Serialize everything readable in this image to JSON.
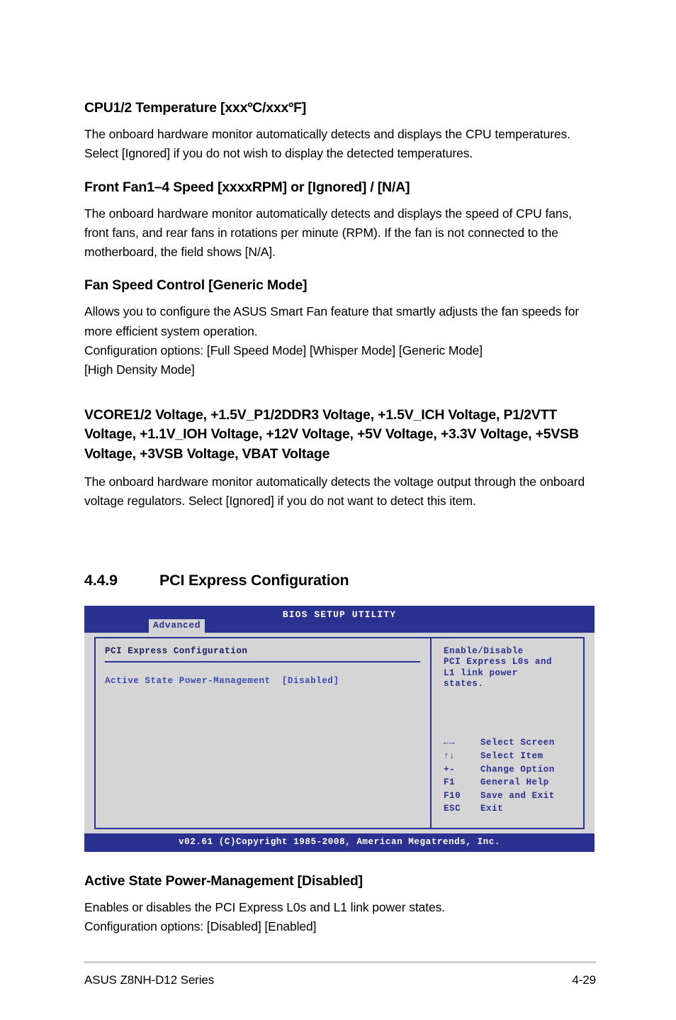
{
  "document": {
    "sections": [
      {
        "heading": "CPU1/2 Temperature [xxxºC/xxxºF]",
        "body": "The onboard hardware monitor automatically detects and displays the CPU temperatures. Select [Ignored] if you do not wish to display the detected temperatures."
      },
      {
        "heading": "Front Fan1–4 Speed [xxxxRPM] or [Ignored] / [N/A]",
        "body": "The onboard hardware monitor automatically detects and displays the speed of CPU fans, front fans, and rear fans in rotations per minute (RPM). If the fan is not connected to the motherboard, the field shows [N/A]."
      },
      {
        "heading": "Fan Speed Control [Generic Mode]",
        "body": "Allows you to configure the ASUS Smart Fan feature that smartly adjusts the fan speeds for more efficient system operation.\nConfiguration options: [Full Speed Mode] [Whisper Mode] [Generic Mode]\n[High Density Mode]"
      },
      {
        "heading": "VCORE1/2 Voltage, +1.5V_P1/2DDR3 Voltage, +1.5V_ICH Voltage, P1/2VTT Voltage, +1.1V_IOH Voltage, +12V Voltage, +5V Voltage, +3.3V Voltage, +5VSB Voltage, +3VSB Voltage, VBAT Voltage",
        "body": "The onboard hardware monitor automatically detects the voltage output through the onboard voltage regulators. Select [Ignored] if you do not want to detect this item."
      }
    ],
    "section_heading": {
      "number": "4.4.9",
      "title": "PCI Express Configuration"
    },
    "after_sections": [
      {
        "heading": "Active State Power-Management [Disabled]",
        "body": "Enables or disables the PCI Express L0s and L1 link power states.\nConfiguration options: [Disabled] [Enabled]"
      }
    ],
    "footer": {
      "left": "ASUS Z8NH-D12 Series",
      "right": "4-29"
    }
  },
  "bios": {
    "title": "BIOS SETUP UTILITY",
    "active_tab": "Advanced",
    "main_panel": {
      "sub_title": "PCI Express Configuration",
      "rows": [
        {
          "label": "Active State Power-Management",
          "value": "[Disabled]"
        }
      ]
    },
    "help_panel": {
      "text": "Enable/Disable\nPCI Express L0s and\nL1 link power\nstates."
    },
    "legend": [
      {
        "key": "←→",
        "action": "Select Screen"
      },
      {
        "key": "↑↓",
        "action": "Select Item"
      },
      {
        "key": "+-",
        "action": "Change Option"
      },
      {
        "key": "F1",
        "action": "General Help"
      },
      {
        "key": "F10",
        "action": "Save and Exit"
      },
      {
        "key": "ESC",
        "action": "Exit"
      }
    ],
    "footer": "v02.61 (C)Copyright 1985-2008, American Megatrends, Inc.",
    "colors": {
      "chrome": "#2b3190",
      "panel_bg": "#d5d5d5",
      "row_text": "#3b4ab0",
      "tab_bg": "#d2d2d2"
    }
  }
}
